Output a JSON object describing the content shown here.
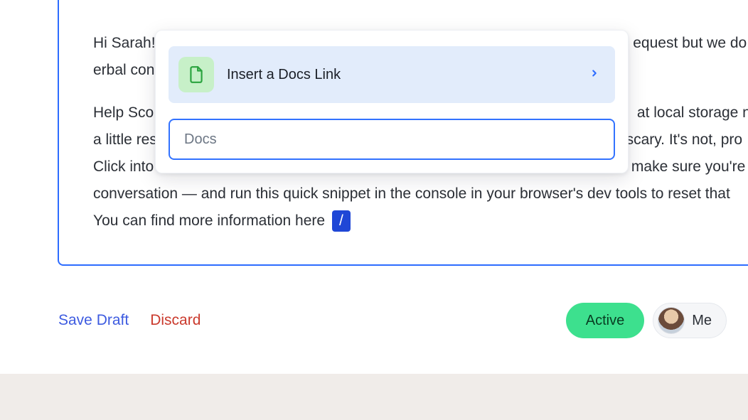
{
  "compose": {
    "para1_line1_pre": "Hi Sarah!",
    "para1_line1_post": "equest but we do",
    "para1_line2": "erbal con",
    "para2_line1_pre": "Help Sco",
    "para2_line1_post": "at local storage n",
    "para2_line2_pre": " a little res",
    "para2_line2_post": "scary. It's not, pro",
    "para2_line3_pre": "Click into",
    "para2_line3_post": "make sure you're",
    "para2_line4": "conversation — and run this quick snippet in the console in your browser's dev tools to reset that",
    "para2_line5_text": "You can find more information here",
    "slash_trigger": "/"
  },
  "popover": {
    "option_label": "Insert a Docs Link",
    "input_value": "Docs",
    "input_placeholder": ""
  },
  "actions": {
    "save_draft": "Save Draft",
    "discard": "Discard",
    "status_pill": "Active",
    "assignee_pill": "Me"
  },
  "colors": {
    "accent_blue": "#2d6cff",
    "green_pill": "#3de08e",
    "danger": "#ca3a2d"
  }
}
